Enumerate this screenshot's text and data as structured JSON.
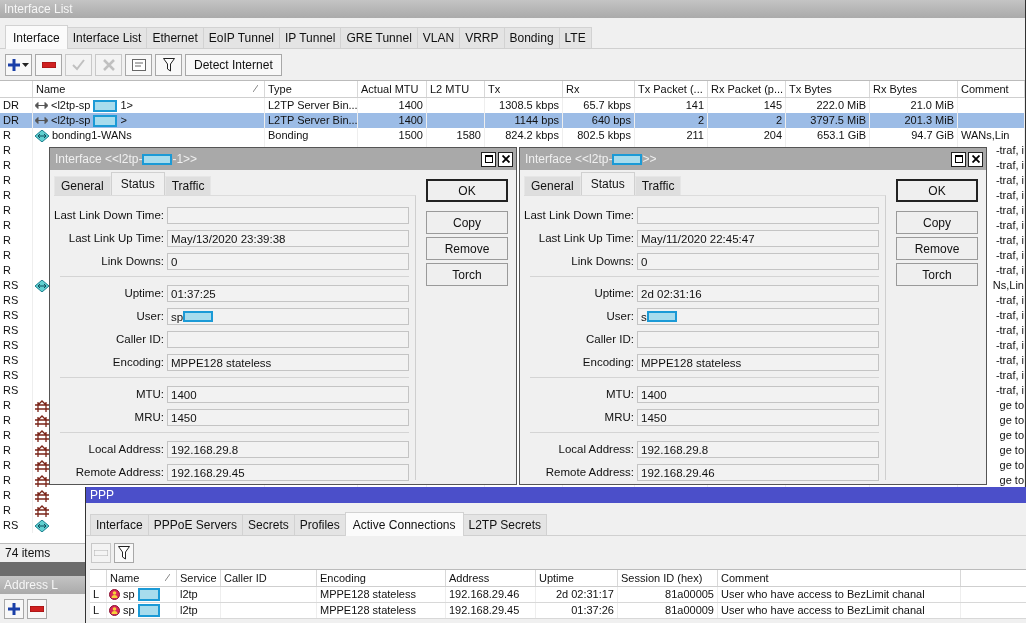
{
  "interface_list": {
    "title": "Interface List",
    "tabs": [
      {
        "label": "Interface",
        "selected": true
      },
      {
        "label": "Interface List",
        "selected": false
      },
      {
        "label": "Ethernet",
        "selected": false
      },
      {
        "label": "EoIP Tunnel",
        "selected": false
      },
      {
        "label": "IP Tunnel",
        "selected": false
      },
      {
        "label": "GRE Tunnel",
        "selected": false
      },
      {
        "label": "VLAN",
        "selected": false
      },
      {
        "label": "VRRP",
        "selected": false
      },
      {
        "label": "Bonding",
        "selected": false
      },
      {
        "label": "LTE",
        "selected": false
      }
    ],
    "tools": [
      {
        "kind": "add",
        "disabled": false
      },
      {
        "kind": "remove",
        "disabled": false
      },
      {
        "kind": "enable",
        "disabled": true
      },
      {
        "kind": "disable",
        "disabled": true
      },
      {
        "kind": "comment",
        "disabled": false
      },
      {
        "kind": "filter",
        "disabled": false
      }
    ],
    "detect_button": "Detect Internet",
    "table": {
      "columns": [
        "Name",
        "Type",
        "Actual MTU",
        "L2 MTU",
        "Tx",
        "Rx",
        "Tx Packet (...",
        "Rx Packet (p...",
        "Tx Bytes",
        "Rx Bytes",
        "Comment"
      ],
      "rows": [
        {
          "flags": "DR",
          "kind": "l2tp",
          "name": "<l2tp-sp",
          "redacted": true,
          "name_end": "1>",
          "type": "L2TP Server Bin...",
          "actual_mtu": "1400",
          "tx": "1308.5 kbps",
          "rx": "65.7 kbps",
          "tx_packets": "141",
          "rx_packets": "145",
          "tx_bytes": "222.0 MiB",
          "rx_bytes": "21.0 MiB",
          "selected": false
        },
        {
          "flags": "DR",
          "kind": "l2tp",
          "name": "<l2tp-sp",
          "redacted": true,
          "name_end": ">",
          "type": "L2TP Server Bin...",
          "actual_mtu": "1400",
          "tx": "1144 bps",
          "rx": "640 bps",
          "tx_packets": "2",
          "rx_packets": "2",
          "tx_bytes": "3797.5 MiB",
          "rx_bytes": "201.3 MiB",
          "selected": true
        },
        {
          "flags": "R",
          "kind": "bonding",
          "name": "bonding1-WANs",
          "type": "Bonding",
          "actual_mtu": "1500",
          "l2_mtu": "1580",
          "tx": "824.2 kbps",
          "rx": "802.5 kbps",
          "tx_packets": "211",
          "rx_packets": "204",
          "tx_bytes": "653.1 GiB",
          "rx_bytes": "94.7 GiB",
          "comment": "WANs,Lin",
          "selected": false
        },
        {
          "flags": "R",
          "kind": "plain",
          "comment": "-traf, i",
          "selected": false
        },
        {
          "flags": "R",
          "kind": "plain",
          "comment": "-traf, i",
          "selected": false
        },
        {
          "flags": "R",
          "kind": "plain",
          "comment": "-traf, i",
          "selected": false
        },
        {
          "flags": "R",
          "kind": "plain",
          "comment": "-traf, i",
          "selected": false
        },
        {
          "flags": "R",
          "kind": "plain",
          "comment": "-traf, i",
          "selected": false
        },
        {
          "flags": "R",
          "kind": "plain",
          "comment": "-traf, i",
          "selected": false
        },
        {
          "flags": "R",
          "kind": "plain",
          "comment": "-traf, i",
          "selected": false
        },
        {
          "flags": "R",
          "kind": "plain",
          "comment": "-traf, i",
          "selected": false
        },
        {
          "flags": "R",
          "kind": "plain",
          "comment": "-traf, i",
          "selected": false
        },
        {
          "flags": "RS",
          "kind": "bonding",
          "comment": "Ns,Lin",
          "selected": false
        },
        {
          "flags": "RS",
          "kind": "plain",
          "comment": "-traf, i",
          "selected": false
        },
        {
          "flags": "RS",
          "kind": "plain",
          "comment": "-traf, i",
          "selected": false
        },
        {
          "flags": "RS",
          "kind": "plain",
          "comment": "-traf, i",
          "selected": false
        },
        {
          "flags": "RS",
          "kind": "plain",
          "comment": "-traf, i",
          "selected": false
        },
        {
          "flags": "RS",
          "kind": "plain",
          "comment": "-traf, i",
          "selected": false
        },
        {
          "flags": "RS",
          "kind": "plain",
          "comment": "-traf, i",
          "selected": false
        },
        {
          "flags": "RS",
          "kind": "plain",
          "comment": "-traf, i",
          "selected": false
        },
        {
          "flags": "R",
          "kind": "vlan",
          "comment": "ge to",
          "selected": false
        },
        {
          "flags": "R",
          "kind": "vlan",
          "comment": "ge to",
          "selected": false
        },
        {
          "flags": "R",
          "kind": "vlan",
          "comment": "ge to",
          "selected": false
        },
        {
          "flags": "R",
          "kind": "vlan",
          "comment": "ge to",
          "selected": false
        },
        {
          "flags": "R",
          "kind": "vlan",
          "comment": "ge to",
          "selected": false
        },
        {
          "flags": "R",
          "kind": "vlan",
          "comment": "ge to",
          "selected": false
        },
        {
          "flags": "R",
          "kind": "vlan",
          "selected": false
        },
        {
          "flags": "R",
          "kind": "vlan",
          "selected": false
        },
        {
          "flags": "RS",
          "kind": "bonding",
          "selected": false
        }
      ]
    },
    "status": "74 items"
  },
  "dialogs": [
    {
      "title": "Interface <<l2tp-",
      "title_end": "-1>>",
      "tabs": [
        {
          "label": "General",
          "selected": false
        },
        {
          "label": "Status",
          "selected": true
        },
        {
          "label": "Traffic",
          "selected": false
        }
      ],
      "groups": [
        [
          {
            "label": "Last Link Down Time:"
          },
          {
            "label": "Last Link Up Time:",
            "value": "May/13/2020 23:39:38"
          },
          {
            "label": "Link Downs:",
            "value": "0"
          }
        ],
        [
          {
            "label": "Uptime:",
            "value": "01:37:25"
          },
          {
            "label": "User:",
            "value": "sp",
            "redacted": true
          },
          {
            "label": "Caller ID:"
          },
          {
            "label": "Encoding:",
            "value": "MPPE128 stateless"
          }
        ],
        [
          {
            "label": "MTU:",
            "value": "1400"
          },
          {
            "label": "MRU:",
            "value": "1450"
          }
        ],
        [
          {
            "label": "Local Address:",
            "value": "192.168.29.8"
          },
          {
            "label": "Remote Address:",
            "value": "192.168.29.45"
          }
        ]
      ],
      "buttons": [
        {
          "label": "OK",
          "default": true
        },
        {
          "label": "Copy",
          "default": false
        },
        {
          "label": "Remove",
          "default": false
        },
        {
          "label": "Torch",
          "default": false
        }
      ]
    },
    {
      "title": "Interface <<l2tp-",
      "title_end": ">>",
      "tabs": [
        {
          "label": "General",
          "selected": false
        },
        {
          "label": "Status",
          "selected": true
        },
        {
          "label": "Traffic",
          "selected": false
        }
      ],
      "groups": [
        [
          {
            "label": "Last Link Down Time:"
          },
          {
            "label": "Last Link Up Time:",
            "value": "May/11/2020 22:45:47"
          },
          {
            "label": "Link Downs:",
            "value": "0"
          }
        ],
        [
          {
            "label": "Uptime:",
            "value": "2d 02:31:16"
          },
          {
            "label": "User:",
            "value": "s",
            "redacted": true
          },
          {
            "label": "Caller ID:"
          },
          {
            "label": "Encoding:",
            "value": "MPPE128 stateless"
          }
        ],
        [
          {
            "label": "MTU:",
            "value": "1400"
          },
          {
            "label": "MRU:",
            "value": "1450"
          }
        ],
        [
          {
            "label": "Local Address:",
            "value": "192.168.29.8"
          },
          {
            "label": "Remote Address:",
            "value": "192.168.29.46"
          }
        ]
      ],
      "buttons": [
        {
          "label": "OK",
          "default": true
        },
        {
          "label": "Copy",
          "default": false
        },
        {
          "label": "Remove",
          "default": false
        },
        {
          "label": "Torch",
          "default": false
        }
      ]
    }
  ],
  "ppp": {
    "title": "PPP",
    "tabs": [
      {
        "label": "Interface",
        "selected": false
      },
      {
        "label": "PPPoE Servers",
        "selected": false
      },
      {
        "label": "Secrets",
        "selected": false
      },
      {
        "label": "Profiles",
        "selected": false
      },
      {
        "label": "Active Connections",
        "selected": true
      },
      {
        "label": "L2TP Secrets",
        "selected": false
      }
    ],
    "tools": [
      {
        "kind": "remove",
        "disabled": true
      },
      {
        "kind": "filter",
        "disabled": false
      }
    ],
    "table": {
      "columns": [
        "Name",
        "Service",
        "Caller ID",
        "Encoding",
        "Address",
        "Uptime",
        "Session ID (hex)",
        "Comment"
      ],
      "rows": [
        {
          "flags": "L",
          "name": "sp",
          "redacted": true,
          "service": "l2tp",
          "encoding": "MPPE128 stateless",
          "address": "192.168.29.46",
          "uptime": "2d 02:31:17",
          "session_id": "81a00005",
          "comment": "User who have access to BezLimit chanal",
          "selected": false
        },
        {
          "flags": "L",
          "name": "sp",
          "redacted": true,
          "service": "l2tp",
          "encoding": "MPPE128 stateless",
          "address": "192.168.29.45",
          "uptime": "01:37:26",
          "session_id": "81a00009",
          "comment": "User who have access to BezLimit chanal",
          "selected": false
        }
      ]
    }
  },
  "address_list": {
    "title": "Address L",
    "tools": [
      {
        "kind": "add",
        "disabled": false
      },
      {
        "kind": "remove",
        "disabled": false
      }
    ]
  }
}
